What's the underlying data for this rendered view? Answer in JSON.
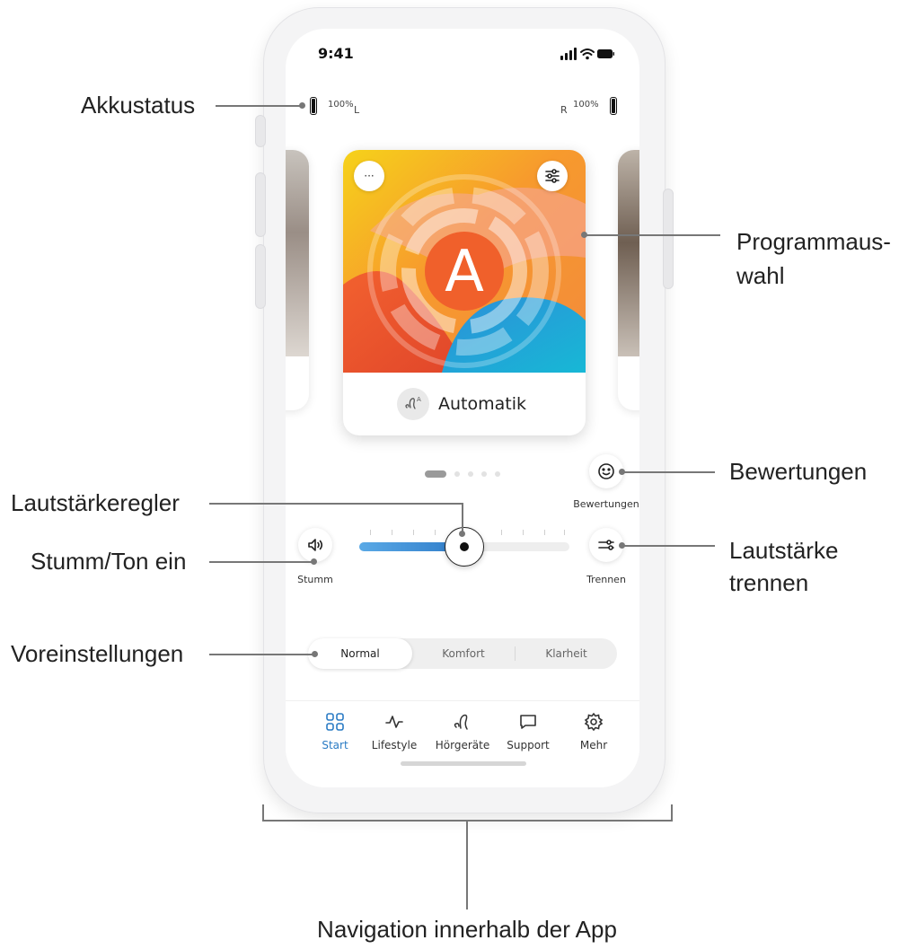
{
  "status": {
    "time": "9:41"
  },
  "battery": {
    "left": {
      "percent": "100%",
      "side": "L"
    },
    "right": {
      "percent": "100%",
      "side": "R"
    }
  },
  "program": {
    "name": "Automatik",
    "letter": "A",
    "more_label": "···",
    "carousel_active_index": 0,
    "carousel_count": 5
  },
  "controls": {
    "ratings_label": "Bewertungen",
    "mute_label": "Stumm",
    "split_label": "Trennen",
    "volume_level": 0.5
  },
  "presets": {
    "items": [
      "Normal",
      "Komfort",
      "Klarheit"
    ],
    "selected": "Normal"
  },
  "tabs": [
    {
      "label": "Start",
      "icon": "grid-icon",
      "active": true
    },
    {
      "label": "Lifestyle",
      "icon": "pulse-icon",
      "active": false
    },
    {
      "label": "Hörgeräte",
      "icon": "hearing-aid-icon",
      "active": false
    },
    {
      "label": "Support",
      "icon": "chat-icon",
      "active": false
    },
    {
      "label": "Mehr",
      "icon": "gear-icon",
      "active": false
    }
  ],
  "callouts": {
    "battery": "Akkustatus",
    "program_line1": "Programmaus-",
    "program_line2": "wahl",
    "ratings": "Bewertungen",
    "volume": "Lautstärkeregler",
    "mute": "Stumm/Ton ein",
    "split_line1": "Lautstärke",
    "split_line2": "trennen",
    "presets": "Voreinstellungen",
    "navigation": "Navigation innerhalb der App"
  },
  "colors": {
    "accent": "#2a7bc4",
    "track_fill": "#4a98d8",
    "text": "#222222"
  }
}
